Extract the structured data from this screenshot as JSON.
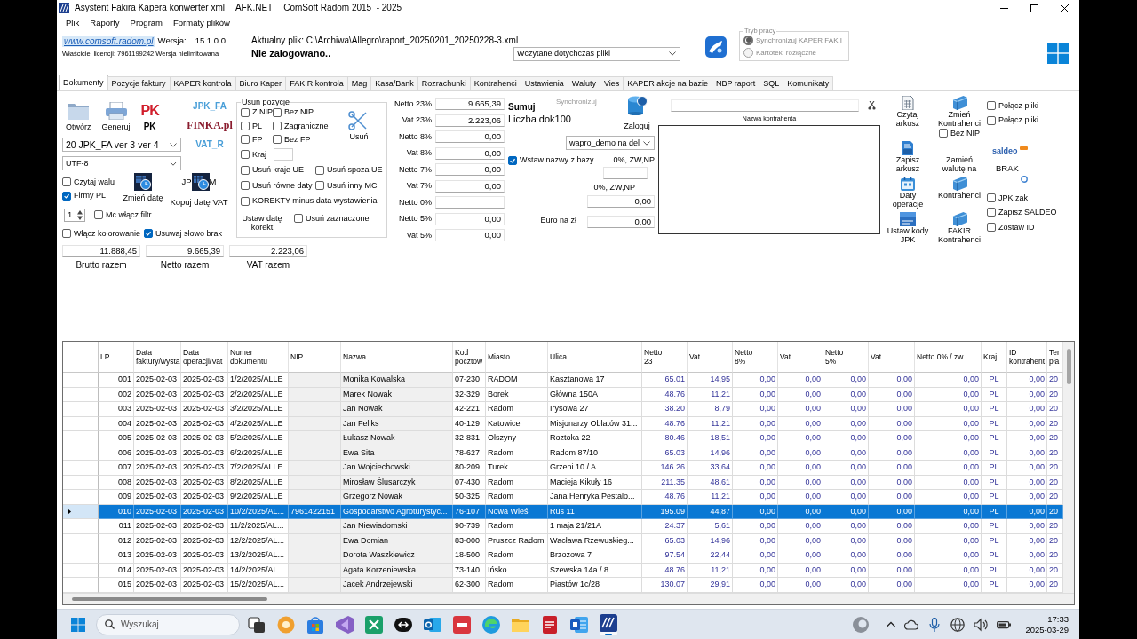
{
  "window": {
    "title": "Asystent Fakira Kapera konwerter xml",
    "title_extra": [
      "AFK.NET",
      "ComSoft Radom 2015  - 2025"
    ]
  },
  "menu": [
    "Plik",
    "Raporty",
    "Program",
    "Formaty plików"
  ],
  "header": {
    "website_link": "www.comsoft.radom.pl",
    "version_label": "Wersja:",
    "version": "15.1.0.0",
    "license": "Właściciel licencji: 7961199242 Wersja nielimitowana",
    "current_file": "Aktualny plik: C:\\Archiwa\\Allegro\\raport_20250201_20250228-3.xml",
    "login_status": "Nie zalogowano..",
    "files_dropdown": "Wczytane dotychczas pliki",
    "work_mode": {
      "title": "Tryb pracy",
      "disabled": true,
      "options": [
        {
          "label": "Synchronizuj KAPER FAKII",
          "selected": true
        },
        {
          "label": "Kartoteki rozłączne",
          "selected": false
        }
      ]
    }
  },
  "tabs": [
    {
      "label": "Dokumenty",
      "selected": true
    },
    {
      "label": "Pozycje faktury",
      "selected": false
    },
    {
      "label": "KAPER kontrola",
      "selected": false
    },
    {
      "label": "Biuro Kaper",
      "selected": false
    },
    {
      "label": "FAKIR kontrola",
      "selected": false
    },
    {
      "label": "Mag",
      "selected": false
    },
    {
      "label": "Kasa/Bank",
      "selected": false
    },
    {
      "label": "Rozrachunki",
      "selected": false
    },
    {
      "label": "Kontrahenci",
      "selected": false
    },
    {
      "label": "Ustawienia",
      "selected": false
    },
    {
      "label": "Waluty",
      "selected": false
    },
    {
      "label": "Vies",
      "selected": false
    },
    {
      "label": "KAPER akcje na bazie",
      "selected": false
    },
    {
      "label": "NBP raport",
      "selected": false
    },
    {
      "label": "SQL",
      "selected": false
    },
    {
      "label": "Komunikaty",
      "selected": false
    }
  ],
  "panel": {
    "left": {
      "open_button": "Otwórz",
      "generate_button": "Generuj",
      "pk_logo": "PK",
      "pk_label": "PK",
      "format_logos": [
        {
          "label": "JPK_FA",
          "kind": "sans"
        },
        {
          "label": "FINKA.pl",
          "kind": "serif"
        },
        {
          "label": "VAT_R",
          "kind": "sans"
        }
      ],
      "format_dropdown": "20 JPK_FA ver 3 ver 4",
      "encoding_dropdown": "UTF-8",
      "checkboxes": [
        {
          "label": "Czytaj walu",
          "checked": false
        },
        {
          "label": "Firmy PL",
          "checked": true
        }
      ],
      "change_date_button": "Zmień datę",
      "jpk_button": {
        "label_before": "JP",
        "label_after": "M"
      },
      "copy_vat_date_button": "Kopuj datę VAT",
      "month_spinner": "1",
      "month_filter": {
        "label": "Mc włącz filtr",
        "checked": false
      },
      "bottom_checkboxes": [
        {
          "label": "Włącz kolorowanie",
          "checked": false
        },
        {
          "label": "Usuwaj słowo brak",
          "checked": true
        }
      ]
    },
    "remove_group": {
      "title": "Usuń pozycje",
      "filter_rows": [
        [
          {
            "label": "Z NIP",
            "checked": false
          },
          {
            "label": "Bez NIP",
            "checked": false
          }
        ],
        [
          {
            "label": "PL",
            "checked": false
          },
          {
            "label": "Zagraniczne",
            "checked": false
          }
        ],
        [
          {
            "label": "FP",
            "checked": false
          },
          {
            "label": "Bez FP",
            "checked": false
          }
        ]
      ],
      "remove_button": "Usuń",
      "country": {
        "label": "Kraj",
        "checked": false
      },
      "option_rows": [
        [
          {
            "label": "Usuń kraje UE",
            "checked": false
          },
          {
            "label": "Usuń spoza UE",
            "checked": false
          }
        ],
        [
          {
            "label": "Usuń równe daty",
            "checked": false
          },
          {
            "label": "Usuń inny MC",
            "checked": false
          }
        ],
        [
          {
            "label": "KOREKTY minus data wystawienia",
            "checked": false
          }
        ]
      ],
      "set_correction_date_button": "Ustaw datę korekt",
      "remove_selected": {
        "label": "Usuń zaznaczone",
        "checked": false
      }
    },
    "totals": [
      {
        "value": "11.888,45",
        "label": "Brutto razem"
      },
      {
        "value": "9.665,39",
        "label": "Netto razem"
      },
      {
        "value": "2.223,06",
        "label": "VAT razem"
      }
    ],
    "rates": [
      {
        "label": "Netto 23%",
        "value": "9.665,39"
      },
      {
        "label": "Vat 23%",
        "value": "2.223,06"
      },
      {
        "label": "Netto 8%",
        "value": "0,00"
      },
      {
        "label": "Vat 8%",
        "value": "0,00"
      },
      {
        "label": "Netto 7%",
        "value": "0,00"
      },
      {
        "label": "Vat 7%",
        "value": "0,00"
      },
      {
        "label": "Netto 0%"
      },
      {
        "label": "Netto 5%",
        "value": "0,00"
      },
      {
        "label": "Vat 5%",
        "value": "0,00"
      }
    ],
    "database": {
      "sum_button": "Sumuj",
      "sync_button": {
        "label": "Synchronizuj",
        "disabled": true
      },
      "login_button": "Zaloguj",
      "document_count": "Liczba dok100",
      "database_dropdown": "wapro_demo na del",
      "insert_names": {
        "label": "Wstaw nazwy z bazy",
        "checked": true
      },
      "zero_rate_label": "0%, ZW,NP",
      "zero_rate_caption": "0%, ZW,NP",
      "zero_rate_value": "0,00",
      "euro_label": "Euro na zł",
      "euro_value": "0,00"
    },
    "contractor": {
      "name_label": "Nazwa kontrahenta"
    },
    "actions": {
      "buttons": [
        {
          "label": "Czytaj arkusz",
          "kind": "sheet"
        },
        {
          "label": "Zmień Kontrahenci",
          "kind": "book"
        },
        {
          "label": "Zapisz arkusz",
          "kind": "csv"
        },
        {
          "label": "Zamień walutę na",
          "kind": "text"
        },
        {
          "label": "Daty operacje",
          "kind": "calendar"
        },
        {
          "label": "Kontrahenci",
          "kind": "book"
        },
        {
          "label": "Ustaw kody JPK",
          "kind": "jpk"
        },
        {
          "label": "FAKIR Kontrahenci",
          "kind": "book"
        }
      ],
      "no_nip": {
        "label": "Bez NIP",
        "checked": false
      }
    },
    "extra": {
      "merge_checkboxes": [
        {
          "label": "Połącz pliki",
          "checked": false
        },
        {
          "label": "Połącz pliki",
          "checked": false
        }
      ],
      "logo": "saldeo",
      "missing_label": "BRAK",
      "checkboxes": [
        {
          "label": "JPK zak",
          "checked": false
        },
        {
          "label": "Zapisz SALDEO",
          "checked": false
        },
        {
          "label": "Zostaw ID",
          "checked": false
        }
      ]
    }
  },
  "grid": {
    "columns": [
      "LP",
      "Data faktury/wysta",
      "Data operacji/Vat",
      "Numer dokumentu",
      "NIP",
      "Nazwa",
      "Kod pocztow",
      "Miasto",
      "Ulica",
      "Netto 23",
      "Vat",
      "Netto 8%",
      "Vat",
      "Netto 5%",
      "Vat",
      "Netto 0% / zw.",
      "Kraj",
      "ID kontrahent",
      "Ter pła"
    ],
    "rows": [
      {
        "selected": false,
        "cells": [
          "001",
          "2025-02-03",
          "2025-02-03",
          "1/2/2025/ALLE",
          null,
          "Monika Kowalska",
          "07-230",
          "RADOM",
          "Kasztanowa 17",
          "65.01",
          "14,95",
          "0,00",
          "0,00",
          "0,00",
          "0,00",
          "0,00",
          "PL",
          "0,00",
          "20"
        ]
      },
      {
        "selected": false,
        "cells": [
          "002",
          "2025-02-03",
          "2025-02-03",
          "2/2/2025/ALLE",
          null,
          "Marek Nowak",
          "32-329",
          "Borek",
          "Główna 150A",
          "48.76",
          "11,21",
          "0,00",
          "0,00",
          "0,00",
          "0,00",
          "0,00",
          "PL",
          "0,00",
          "20"
        ]
      },
      {
        "selected": false,
        "cells": [
          "003",
          "2025-02-03",
          "2025-02-03",
          "3/2/2025/ALLE",
          null,
          "Jan Nowak",
          "42-221",
          "Radom",
          "Irysowa 27",
          "38.20",
          "8,79",
          "0,00",
          "0,00",
          "0,00",
          "0,00",
          "0,00",
          "PL",
          "0,00",
          "20"
        ]
      },
      {
        "selected": false,
        "cells": [
          "004",
          "2025-02-03",
          "2025-02-03",
          "4/2/2025/ALLE",
          null,
          "Jan Feliks",
          "40-129",
          "Katowice",
          "Misjonarzy Oblatów 31...",
          "48.76",
          "11,21",
          "0,00",
          "0,00",
          "0,00",
          "0,00",
          "0,00",
          "PL",
          "0,00",
          "20"
        ]
      },
      {
        "selected": false,
        "cells": [
          "005",
          "2025-02-03",
          "2025-02-03",
          "5/2/2025/ALLE",
          null,
          "Łukasz Nowak",
          "32-831",
          "Olszyny",
          "Roztoka 22",
          "80.46",
          "18,51",
          "0,00",
          "0,00",
          "0,00",
          "0,00",
          "0,00",
          "PL",
          "0,00",
          "20"
        ]
      },
      {
        "selected": false,
        "cells": [
          "006",
          "2025-02-03",
          "2025-02-03",
          "6/2/2025/ALLE",
          null,
          "Ewa Sita",
          "78-627",
          "Radom",
          "Radom 87/10",
          "65.03",
          "14,96",
          "0,00",
          "0,00",
          "0,00",
          "0,00",
          "0,00",
          "PL",
          "0,00",
          "20"
        ]
      },
      {
        "selected": false,
        "cells": [
          "007",
          "2025-02-03",
          "2025-02-03",
          "7/2/2025/ALLE",
          null,
          "Jan Wojciechowski",
          "80-209",
          "Turek",
          "Grzeni 10 / A",
          "146.26",
          "33,64",
          "0,00",
          "0,00",
          "0,00",
          "0,00",
          "0,00",
          "PL",
          "0,00",
          "20"
        ]
      },
      {
        "selected": false,
        "cells": [
          "008",
          "2025-02-03",
          "2025-02-03",
          "8/2/2025/ALLE",
          null,
          "Mirosław Ślusarczyk",
          "07-430",
          "Radom",
          "Macieja Kikuły 16",
          "211.35",
          "48,61",
          "0,00",
          "0,00",
          "0,00",
          "0,00",
          "0,00",
          "PL",
          "0,00",
          "20"
        ]
      },
      {
        "selected": false,
        "cells": [
          "009",
          "2025-02-03",
          "2025-02-03",
          "9/2/2025/ALLE",
          null,
          "Grzegorz Nowak",
          "50-325",
          "Radom",
          "Jana Henryka Pestalo...",
          "48.76",
          "11,21",
          "0,00",
          "0,00",
          "0,00",
          "0,00",
          "0,00",
          "PL",
          "0,00",
          "20"
        ]
      },
      {
        "selected": true,
        "cells": [
          "010",
          "2025-02-03",
          "2025-02-03",
          "10/2/2025/AL...",
          "7961422151",
          "Gospodarstwo Agroturystyc...",
          "76-107",
          "Nowa Wieś",
          "Rus 11",
          "195.09",
          "44,87",
          "0,00",
          "0,00",
          "0,00",
          "0,00",
          "0,00",
          "PL",
          "0,00",
          "20"
        ]
      },
      {
        "selected": false,
        "cells": [
          "011",
          "2025-02-03",
          "2025-02-03",
          "11/2/2025/AL...",
          null,
          "Jan Niewiadomski",
          "90-739",
          "Radom",
          "1 maja 21/21A",
          "24.37",
          "5,61",
          "0,00",
          "0,00",
          "0,00",
          "0,00",
          "0,00",
          "PL",
          "0,00",
          "20"
        ]
      },
      {
        "selected": false,
        "cells": [
          "012",
          "2025-02-03",
          "2025-02-03",
          "12/2/2025/AL...",
          null,
          "Ewa Domian",
          "83-000",
          "Pruszcz Radom",
          "Wacława Rzewuskieg...",
          "65.03",
          "14,96",
          "0,00",
          "0,00",
          "0,00",
          "0,00",
          "0,00",
          "PL",
          "0,00",
          "20"
        ]
      },
      {
        "selected": false,
        "cells": [
          "013",
          "2025-02-03",
          "2025-02-03",
          "13/2/2025/AL...",
          null,
          "Dorota Waszkiewicz",
          "18-500",
          "Radom",
          "Brzozowa 7",
          "97.54",
          "22,44",
          "0,00",
          "0,00",
          "0,00",
          "0,00",
          "0,00",
          "PL",
          "0,00",
          "20"
        ]
      },
      {
        "selected": false,
        "cells": [
          "014",
          "2025-02-03",
          "2025-02-03",
          "14/2/2025/AL...",
          null,
          "Agata Korzeniewska",
          "73-140",
          "Ińsko",
          "Szewska 14a / 8",
          "48.76",
          "11,21",
          "0,00",
          "0,00",
          "0,00",
          "0,00",
          "0,00",
          "PL",
          "0,00",
          "20"
        ]
      },
      {
        "selected": false,
        "cells": [
          "015",
          "2025-02-03",
          "2025-02-03",
          "15/2/2025/AL...",
          null,
          "Jacek Andrzejewski",
          "62-300",
          "Radom",
          "Piastów 1c/28",
          "130.07",
          "29,91",
          "0,00",
          "0,00",
          "0,00",
          "0,00",
          "0,00",
          "PL",
          "0,00",
          "20"
        ]
      }
    ]
  },
  "taskbar": {
    "search": {
      "placeholder": "Wyszukaj"
    },
    "apps": [
      {
        "kind": "task_view",
        "active": false
      },
      {
        "kind": "circle",
        "active": false
      },
      {
        "kind": "store",
        "active": false
      },
      {
        "kind": "ribbon",
        "active": false
      },
      {
        "kind": "tools",
        "active": false
      },
      {
        "kind": "arrows",
        "active": false
      },
      {
        "kind": "mail",
        "active": false
      },
      {
        "kind": "tile",
        "active": false
      },
      {
        "kind": "browser",
        "active": false
      },
      {
        "kind": "folder",
        "active": false
      },
      {
        "kind": "document",
        "active": false
      },
      {
        "kind": "text_document",
        "active": false
      },
      {
        "kind": "app_logo",
        "active": true
      }
    ],
    "time": "17:33",
    "date": "2025-03-29"
  }
}
